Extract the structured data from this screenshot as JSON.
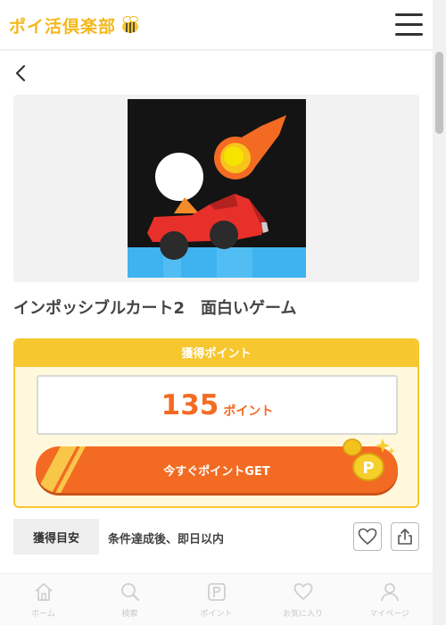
{
  "header": {
    "logo_text": "ポイ活倶楽部",
    "logo_icon": "bee-icon",
    "menu_icon": "hamburger-icon"
  },
  "nav": {
    "back_icon": "chevron-left-icon"
  },
  "app": {
    "title": "インポッシブルカート2　面白いゲーム",
    "icon": "game-car-meteor-icon"
  },
  "points_card": {
    "header": "獲得ポイント",
    "points_value": "135",
    "points_unit": "ポイント",
    "button_label": "今すぐポイントGET"
  },
  "guide": {
    "tag": "獲得目安",
    "text": "条件達成後、即日以内"
  },
  "actions": {
    "favorite_icon": "heart-icon",
    "share_icon": "share-icon"
  },
  "bottom_nav": {
    "items": [
      {
        "label": "ホーム",
        "icon": "home-icon"
      },
      {
        "label": "検索",
        "icon": "search-icon"
      },
      {
        "label": "ポイント",
        "icon": "point-p-icon"
      },
      {
        "label": "お気に入り",
        "icon": "heart-icon"
      },
      {
        "label": "マイページ",
        "icon": "user-icon"
      }
    ]
  },
  "colors": {
    "brand_yellow": "#f6c72e",
    "accent_orange": "#f36b23",
    "logo_yellow": "#f3b81a"
  }
}
